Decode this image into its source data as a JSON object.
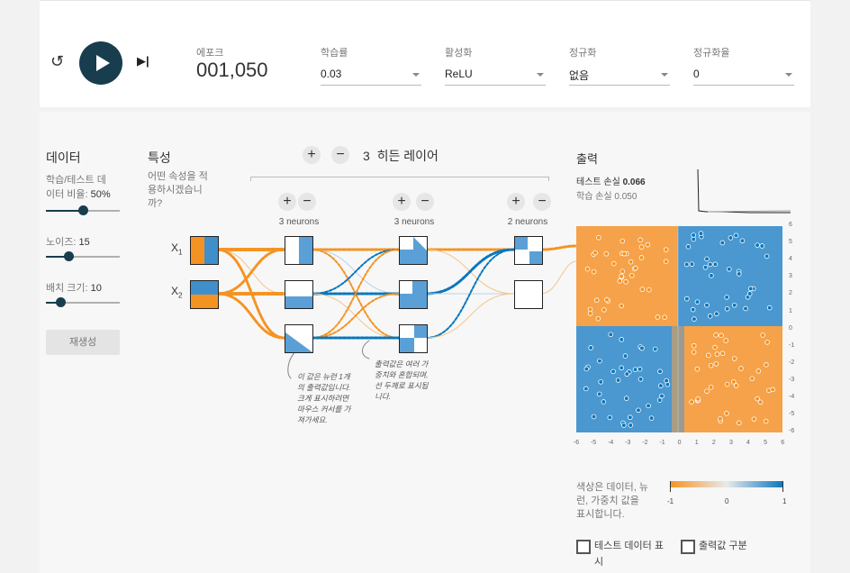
{
  "controls": {
    "epoch_label": "에포크",
    "epoch_value": "001,050",
    "learning_rate": {
      "label": "학습률",
      "value": "0.03"
    },
    "activation": {
      "label": "활성화",
      "value": "ReLU"
    },
    "regularization": {
      "label": "정규화",
      "value": "없음"
    },
    "regularization_rate": {
      "label": "정규화율",
      "value": "0"
    }
  },
  "data_panel": {
    "title": "데이터",
    "ratio_label_line1": "학습/테스트 데",
    "ratio_label_line2": "이터 비율:",
    "ratio_value": "50%",
    "ratio_fraction": 0.5,
    "noise_label": "노이즈:",
    "noise_value": "15",
    "noise_fraction": 0.3,
    "batch_label": "배치 크기:",
    "batch_value": "10",
    "batch_fraction": 0.2,
    "regenerate": "재생성"
  },
  "features": {
    "title": "특성",
    "question_line1": "어떤 속성을 적",
    "question_line2": "용하시겠습니",
    "question_line3": "까?",
    "x1": "X",
    "x1_sub": "1",
    "x2": "X",
    "x2_sub": "2"
  },
  "hidden": {
    "count": "3",
    "title": "히든 레이어",
    "plus": "+",
    "minus": "−",
    "layers": [
      {
        "neurons": "3 neurons"
      },
      {
        "neurons": "3 neurons"
      },
      {
        "neurons": "2 neurons"
      }
    ],
    "annotation1": [
      "이 값은 뉴런 1개",
      "의 출력값입니다.",
      "크게 표시하려면",
      "마우스 커서를 가",
      "져가세요."
    ],
    "annotation2": [
      "출력값은 여러 가",
      "중치와 혼합되며,",
      "선 두께로 표시됩",
      "니다."
    ]
  },
  "output": {
    "title": "출력",
    "test_loss_label": "테스트 손실",
    "test_loss": "0.066",
    "train_loss_label": "학습 손실",
    "train_loss": "0.050",
    "x_ticks": [
      "-6",
      "-5",
      "-4",
      "-3",
      "-2",
      "-1",
      "0",
      "1",
      "2",
      "3",
      "4",
      "5",
      "6"
    ],
    "y_ticks": [
      "6",
      "5",
      "4",
      "3",
      "2",
      "1",
      "0",
      "-1",
      "-2",
      "-3",
      "-4",
      "-5",
      "-6"
    ],
    "legend_text": [
      "색상은 데이터, 뉴",
      "런, 가중치 값을",
      "표시합니다."
    ],
    "legend_ticks": [
      "-1",
      "0",
      "1"
    ],
    "show_test_label": [
      "테스트 데이터 표",
      "시"
    ],
    "discretize_label": "출력값 구분"
  },
  "colors": {
    "orange": "#f59322",
    "blue": "#0877bd",
    "dark": "#183d4e"
  }
}
